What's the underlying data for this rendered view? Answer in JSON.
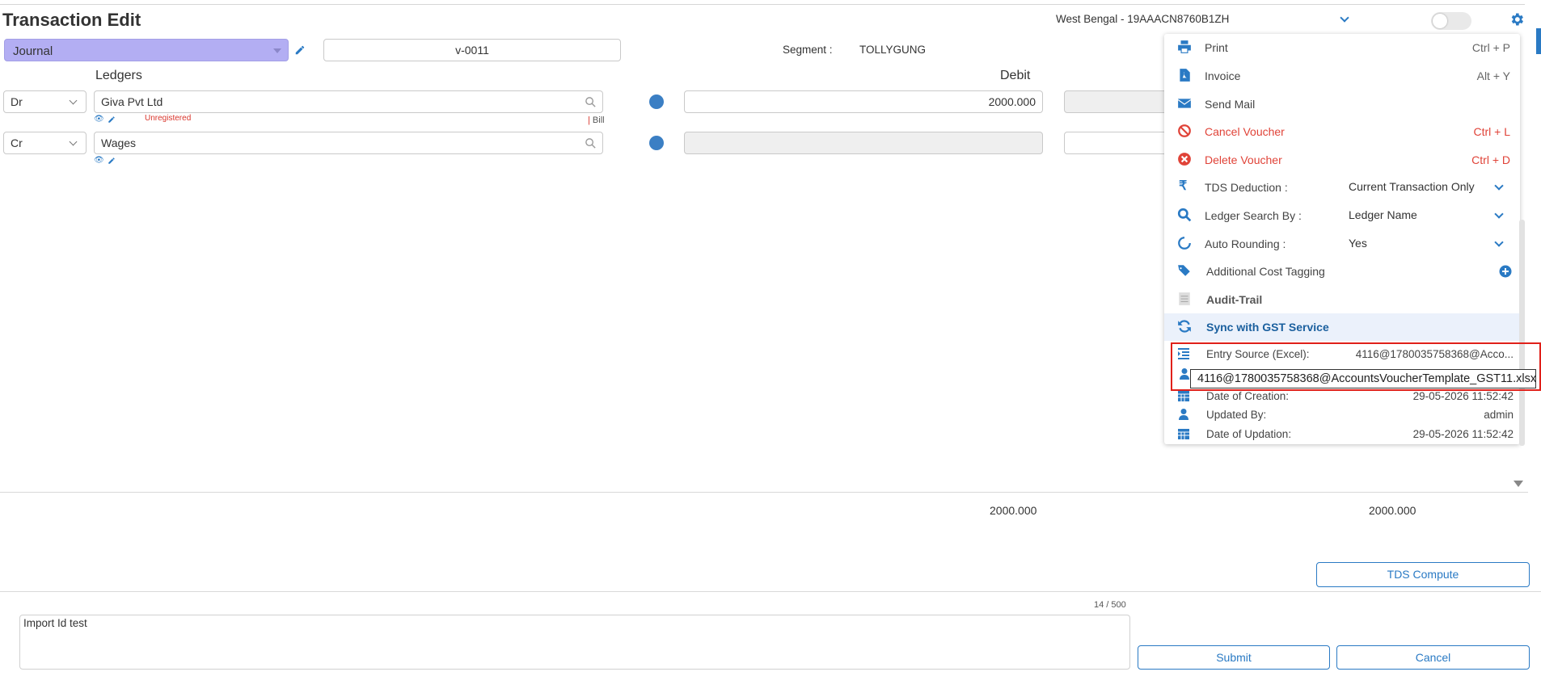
{
  "header": {
    "title": "Transaction Edit",
    "gstin_select": "West Bengal - 19AAACN8760B1ZH"
  },
  "voucher": {
    "type": "Journal",
    "number": "v-0011",
    "segment_label": "Segment :",
    "segment_value": "TOLLYGUNG"
  },
  "table": {
    "col_ledgers": "Ledgers",
    "col_debit": "Debit",
    "rows": [
      {
        "drcr": "Dr",
        "ledger": "Giva Pvt Ltd",
        "status": "Unregistered",
        "bill": "Bill",
        "debit": "2000.000",
        "credit": ""
      },
      {
        "drcr": "Cr",
        "ledger": "Wages",
        "debit": "",
        "credit": ""
      }
    ]
  },
  "totals": {
    "debit": "2000.000",
    "credit": "2000.000"
  },
  "narration": {
    "text": "Import Id test",
    "count": "14 / 500"
  },
  "buttons": {
    "tds_compute": "TDS Compute",
    "submit": "Submit",
    "cancel": "Cancel"
  },
  "menu": {
    "print": {
      "label": "Print",
      "shortcut": "Ctrl + P"
    },
    "invoice": {
      "label": "Invoice",
      "shortcut": "Alt + Y"
    },
    "send_mail": {
      "label": "Send Mail"
    },
    "cancel_voucher": {
      "label": "Cancel Voucher",
      "shortcut": "Ctrl + L"
    },
    "delete_voucher": {
      "label": "Delete Voucher",
      "shortcut": "Ctrl + D"
    },
    "tds_deduction": {
      "label": "TDS Deduction :",
      "value": "Current Transaction Only"
    },
    "ledger_search": {
      "label": "Ledger Search By :",
      "value": "Ledger Name"
    },
    "auto_rounding": {
      "label": "Auto Rounding :",
      "value": "Yes"
    },
    "additional_cost": {
      "label": "Additional Cost Tagging"
    },
    "audit_trail": {
      "label": "Audit-Trail"
    },
    "sync_gst": {
      "label": "Sync with GST Service"
    },
    "entry_source": {
      "label": "Entry Source (Excel):",
      "value": "4116@1780035758368@Acco..."
    },
    "date_created": {
      "label": "Date of Creation:",
      "value": "29-05-2026 11:52:42"
    },
    "updated_by": {
      "label": "Updated By:",
      "value": "admin"
    },
    "date_updated": {
      "label": "Date of Updation:",
      "value": "29-05-2026 11:52:42"
    },
    "tooltip": "4116@1780035758368@AccountsVoucherTemplate_GST11.xlsx"
  },
  "colors": {
    "accent": "#2a7ac4",
    "voucher_bg": "#b3aef3",
    "danger": "#e04338",
    "highlight": "#e0201a"
  }
}
